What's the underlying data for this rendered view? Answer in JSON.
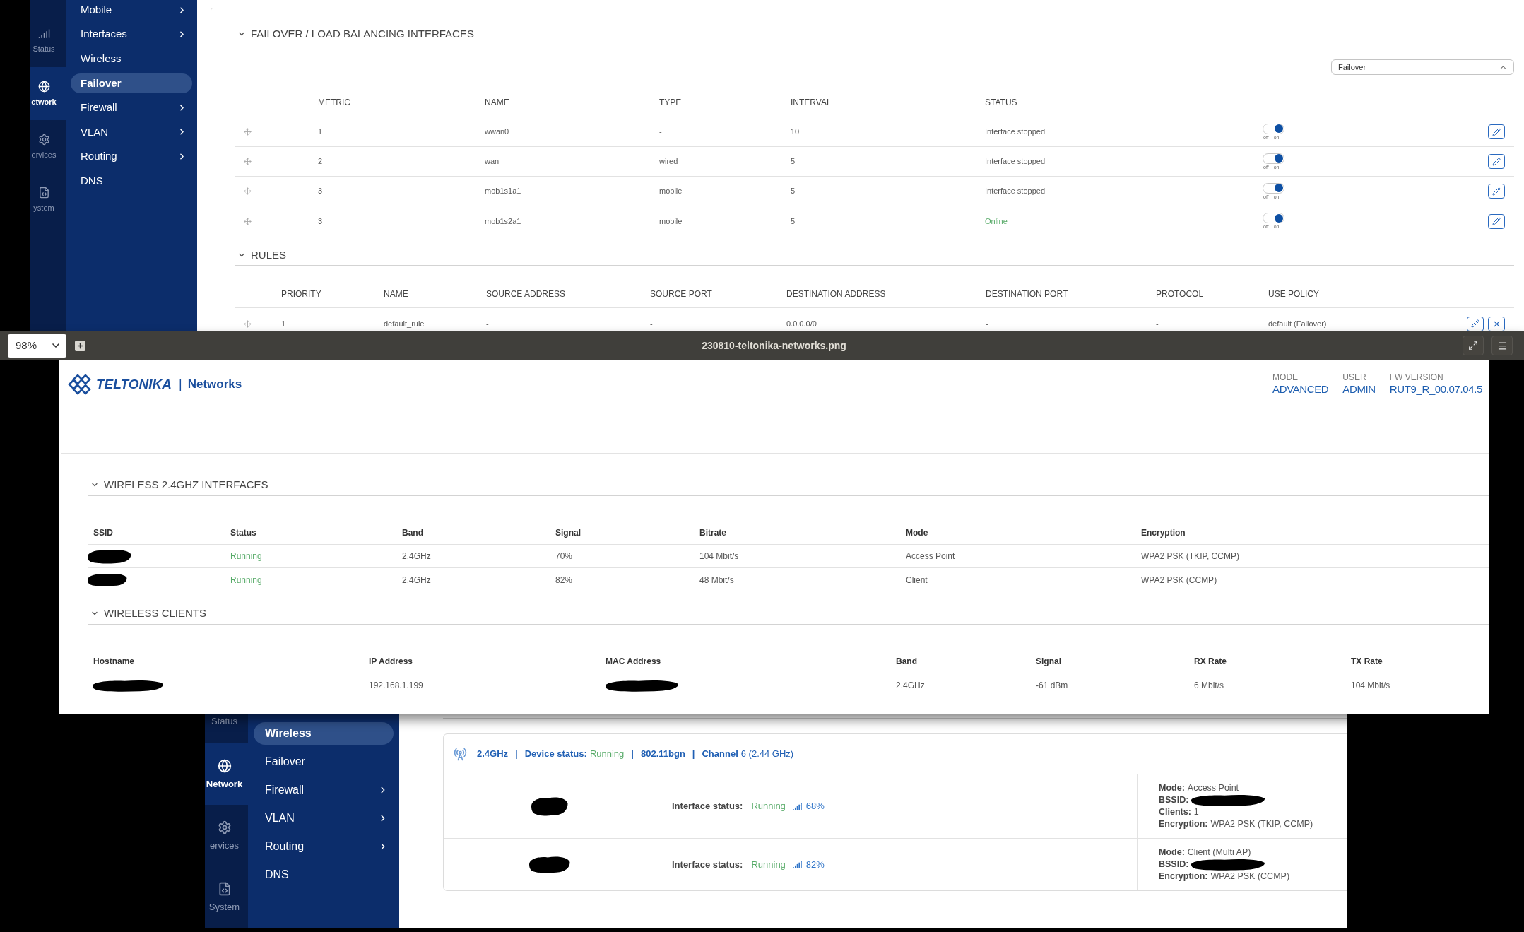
{
  "top_screenshot": {
    "rail": [
      {
        "kind": "status",
        "label": "Status",
        "selected": false
      },
      {
        "kind": "network",
        "label": "etwork",
        "selected": true
      },
      {
        "kind": "services",
        "label": "ervices",
        "selected": false
      },
      {
        "kind": "system",
        "label": "ystem",
        "selected": false
      }
    ],
    "menu": [
      {
        "label": "Mobile",
        "has_submenu": true,
        "selected": false
      },
      {
        "label": "Interfaces",
        "has_submenu": true,
        "selected": false
      },
      {
        "label": "Wireless",
        "has_submenu": false,
        "selected": false
      },
      {
        "label": "Failover",
        "has_submenu": false,
        "selected": true
      },
      {
        "label": "Firewall",
        "has_submenu": true,
        "selected": false
      },
      {
        "label": "VLAN",
        "has_submenu": true,
        "selected": false
      },
      {
        "label": "Routing",
        "has_submenu": true,
        "selected": false
      },
      {
        "label": "DNS",
        "has_submenu": false,
        "selected": false
      }
    ],
    "interfaces_section": {
      "title": "FAILOVER / LOAD BALANCING INTERFACES",
      "mode_select": {
        "value": "Failover"
      },
      "columns": [
        "METRIC",
        "NAME",
        "TYPE",
        "INTERVAL",
        "STATUS"
      ],
      "rows": [
        {
          "metric": "1",
          "name": "wwan0",
          "type": "-",
          "interval": "10",
          "status": "Interface stopped",
          "online": false,
          "toggle": {
            "on": true,
            "off_label": "off",
            "on_label": "on"
          }
        },
        {
          "metric": "2",
          "name": "wan",
          "type": "wired",
          "interval": "5",
          "status": "Interface stopped",
          "online": false,
          "toggle": {
            "on": true,
            "off_label": "off",
            "on_label": "on"
          }
        },
        {
          "metric": "3",
          "name": "mob1s1a1",
          "type": "mobile",
          "interval": "5",
          "status": "Interface stopped",
          "online": false,
          "toggle": {
            "on": true,
            "off_label": "off",
            "on_label": "on"
          }
        },
        {
          "metric": "3",
          "name": "mob1s2a1",
          "type": "mobile",
          "interval": "5",
          "status": "Online",
          "online": true,
          "toggle": {
            "on": true,
            "off_label": "off",
            "on_label": "on"
          }
        }
      ]
    },
    "rules_section": {
      "title": "RULES",
      "columns": [
        "PRIORITY",
        "NAME",
        "SOURCE ADDRESS",
        "SOURCE PORT",
        "DESTINATION ADDRESS",
        "DESTINATION PORT",
        "PROTOCOL",
        "USE POLICY"
      ],
      "rows": [
        {
          "cells": [
            "1",
            "default_rule",
            "-",
            "-",
            "0.0.0.0/0",
            "-",
            "-",
            "default (Failover)"
          ]
        }
      ]
    }
  },
  "viewer": {
    "zoom": "98%",
    "title": "230810-teltonika-networks.png",
    "page": {
      "logo": {
        "brand": "TELTONIKA",
        "separator": "|",
        "product": "Networks"
      },
      "info": [
        {
          "label": "MODE",
          "value": "ADVANCED"
        },
        {
          "label": "USER",
          "value": "ADMIN"
        },
        {
          "label": "FW VERSION",
          "value": "RUT9_R_00.07.04.5"
        }
      ],
      "interfaces_section": {
        "title": "WIRELESS 2.4GHZ INTERFACES",
        "columns": [
          "SSID",
          "Status",
          "Band",
          "Signal",
          "Bitrate",
          "Mode",
          "Encryption"
        ],
        "rows": [
          {
            "ssid_redacted": true,
            "status": "Running",
            "running": true,
            "band": "2.4GHz",
            "signal": "70%",
            "bitrate": "104 Mbit/s",
            "mode": "Access Point",
            "encryption": "WPA2 PSK (TKIP, CCMP)"
          },
          {
            "ssid_redacted": true,
            "status": "Running",
            "running": true,
            "band": "2.4GHz",
            "signal": "82%",
            "bitrate": "48 Mbit/s",
            "mode": "Client",
            "encryption": "WPA2 PSK (CCMP)"
          }
        ]
      },
      "clients_section": {
        "title": "WIRELESS CLIENTS",
        "columns": [
          "Hostname",
          "IP Address",
          "MAC Address",
          "Band",
          "Signal",
          "RX Rate",
          "TX Rate"
        ],
        "rows": [
          {
            "hostname_redacted": true,
            "ip": "192.168.1.199",
            "mac_redacted": true,
            "band": "2.4GHz",
            "signal": "-61 dBm",
            "rx_rate": "6 Mbit/s",
            "tx_rate": "104 Mbit/s"
          }
        ]
      }
    }
  },
  "bottom_screenshot": {
    "rail": [
      {
        "label": "Status",
        "selected": false,
        "cut_off": true
      },
      {
        "kind": "network",
        "label": "Network",
        "selected": true
      },
      {
        "kind": "services",
        "label": "ervices",
        "selected": false
      },
      {
        "kind": "system",
        "label": "System",
        "selected": false
      }
    ],
    "menu": [
      {
        "label": "Wireless",
        "has_submenu": false,
        "selected": true
      },
      {
        "label": "Failover",
        "has_submenu": false,
        "selected": false
      },
      {
        "label": "Firewall",
        "has_submenu": true,
        "selected": false
      },
      {
        "label": "VLAN",
        "has_submenu": true,
        "selected": false
      },
      {
        "label": "Routing",
        "has_submenu": true,
        "selected": false
      },
      {
        "label": "DNS",
        "has_submenu": false,
        "selected": false
      }
    ],
    "wireless_card": {
      "band": "2.4GHz",
      "separators": [
        "|",
        "|",
        "|"
      ],
      "device_status": {
        "label": "Device status:",
        "value": "Running",
        "running": true
      },
      "standard": "802.11bgn",
      "channel": {
        "label": "Channel",
        "value": "6 (2.44 GHz)"
      },
      "rows": [
        {
          "ssid_redacted": true,
          "status_label": "Interface status:",
          "status": "Running",
          "running": true,
          "signal": "68%",
          "details": [
            {
              "label": "Mode:",
              "value": "Access Point"
            },
            {
              "label": "BSSID:",
              "value_redacted": true
            },
            {
              "label": "Clients:",
              "value": "1"
            },
            {
              "label": "Encryption:",
              "value": "WPA2 PSK (TKIP, CCMP)"
            }
          ]
        },
        {
          "ssid_redacted": true,
          "status_label": "Interface status:",
          "status": "Running",
          "running": true,
          "signal": "82%",
          "details": [
            {
              "label": "Mode:",
              "value": "Client (Multi AP)"
            },
            {
              "label": "BSSID:",
              "value_redacted": true
            },
            {
              "label": "Encryption:",
              "value": "WPA2 PSK (CCMP)"
            }
          ]
        }
      ]
    }
  }
}
